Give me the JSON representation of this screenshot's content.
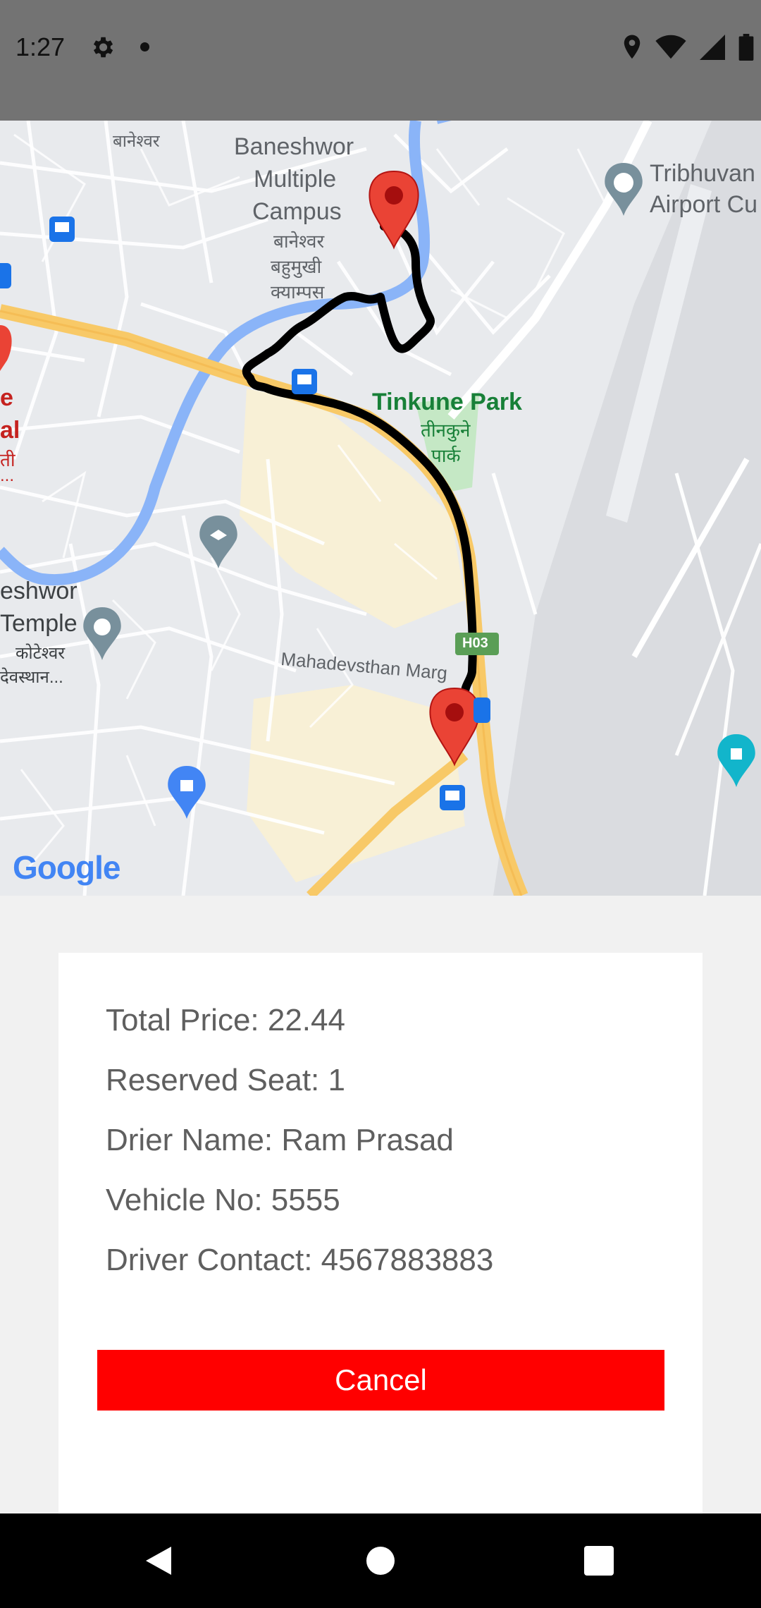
{
  "status_bar": {
    "time": "1:27",
    "icons": [
      "gear-icon",
      "dot-icon",
      "location-icon",
      "wifi-icon",
      "signal-icon",
      "battery-icon"
    ]
  },
  "map": {
    "labels": {
      "banehswor_top": "बानेश्वर",
      "campus_en_1": "Baneshwor",
      "campus_en_2": "Multiple",
      "campus_en_3": "Campus",
      "campus_np_1": "बानेश्वर",
      "campus_np_2": "बहुमुखी",
      "campus_np_3": "क्याम्पस",
      "airport_1": "Tribhuvan",
      "airport_2": "Airport Cu",
      "park_en": "Tinkune Park",
      "park_np_1": "तीनकुने",
      "park_np_2": "पार्क",
      "left_red_1": "e",
      "left_red_2": "al",
      "left_red_3": "ती",
      "left_red_4": "...",
      "temple_1": "eshwor",
      "temple_2": "Temple",
      "temple_np_1": "कोटेश्वर",
      "temple_np_2": "देवस्थान...",
      "road": "Mahadevsthan Marg",
      "highway": "H03",
      "google": "Google"
    },
    "colors": {
      "land": "#e8eaed",
      "road": "#ffffff",
      "main_road": "#f8c967",
      "river": "#8ab4f8",
      "park": "#c5e8c5",
      "route": "#000000",
      "pin": "#ea4335"
    }
  },
  "trip": {
    "total_price": "Total Price: 22.44",
    "reserved_seat": "Reserved Seat: 1",
    "driver_name": "Drier Name: Ram Prasad",
    "vehicle_no": "Vehicle No: 5555",
    "driver_contact": "Driver Contact: 4567883883"
  },
  "actions": {
    "cancel_label": "Cancel",
    "cancel_color": "#ff0000"
  },
  "nav_bar": {
    "icons": [
      "back-icon",
      "home-icon",
      "recents-icon"
    ]
  }
}
